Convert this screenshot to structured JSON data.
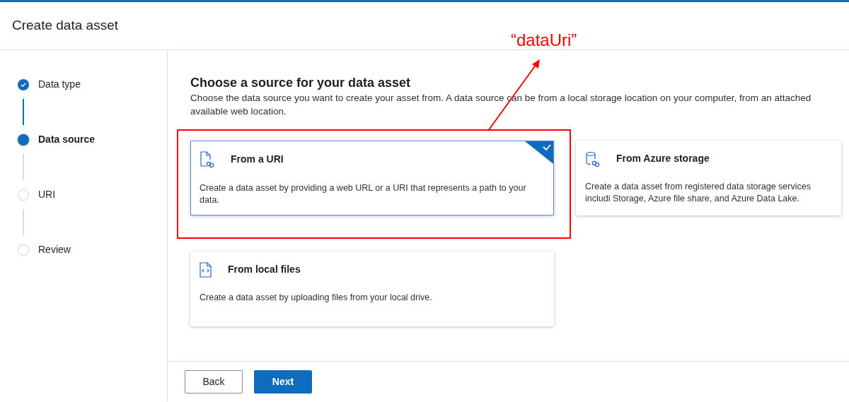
{
  "header": {
    "title": "Create data asset"
  },
  "steps": [
    {
      "label": "Data type",
      "completed": true,
      "selected": false
    },
    {
      "label": "Data source",
      "completed": false,
      "selected": true
    },
    {
      "label": "URI",
      "completed": false,
      "selected": false
    },
    {
      "label": "Review",
      "completed": false,
      "selected": false
    }
  ],
  "content": {
    "heading": "Choose a source for your data asset",
    "description_lines": [
      "Choose the data source you want to create your asset from. A data source can be from a local storage location on your computer, from an attached",
      "available web location."
    ]
  },
  "source_cards": [
    {
      "kind": "uri",
      "title": "From a URI",
      "description": "Create a data asset by providing a web URL or a URI that represents a path to your data.",
      "selected": true
    },
    {
      "kind": "storage",
      "title": "From Azure storage",
      "description": "Create a data asset from registered data storage services includi Storage, Azure file share, and Azure Data Lake.",
      "selected": false
    },
    {
      "kind": "local",
      "title": "From local files",
      "description": "Create a data asset by uploading files from your local drive.",
      "selected": false
    }
  ],
  "buttons": [
    {
      "label": "Back",
      "kind": "secondary"
    },
    {
      "label": "Next",
      "kind": "primary"
    }
  ],
  "annotation": {
    "label": "“dataUri”"
  }
}
